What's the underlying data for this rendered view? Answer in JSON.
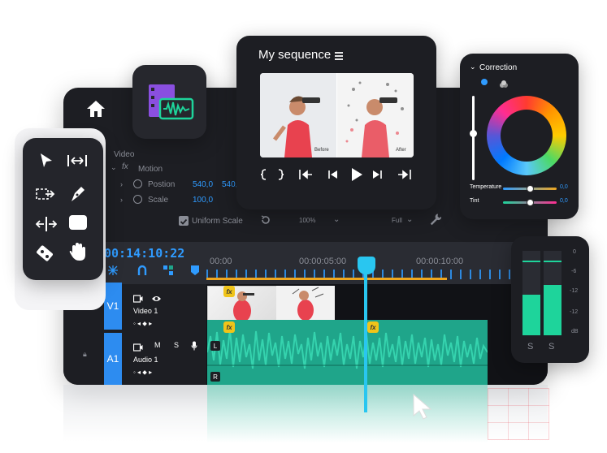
{
  "viewer": {
    "title": "My sequence",
    "before_label": "Before",
    "after_label": "After"
  },
  "effects": {
    "video_label": "Video",
    "motion_label": "Motion",
    "position_label": "Postion",
    "position_x": "540,0",
    "position_y": "540,",
    "scale_label": "Scale",
    "scale_value": "100,0",
    "uniform_scale_label": "Uniform Scale",
    "zoom_value": "100%",
    "quality_value": "Full"
  },
  "timeline": {
    "timecode": "00:14:10:22",
    "ruler": [
      "00:00",
      "00:00:05:00",
      "00:00:10:00"
    ],
    "tracks": [
      {
        "tag": "V1",
        "name": "Video 1",
        "vol": "0"
      },
      {
        "tag": "A1",
        "name": "Audio 1",
        "m_label": "M",
        "s_label": "S",
        "vol": "0",
        "left": "L",
        "right": "R"
      }
    ],
    "fx_label": "fx"
  },
  "correction": {
    "title": "Correction",
    "temperature_label": "Temperature",
    "temperature_value": "0,0",
    "tint_label": "Tint",
    "tint_value": "0,0"
  },
  "meter": {
    "scale": [
      "0",
      "-6",
      "-12",
      "-12",
      "dB"
    ],
    "s_left": "S",
    "s_right": "S"
  },
  "colors": {
    "accent": "#2f9bff",
    "audio": "#1fa58a",
    "meter": "#1ed49b",
    "badge": "#f0c419"
  },
  "icons": [
    "home-icon",
    "media-icon",
    "selection-tool-icon",
    "ripple-tool-icon",
    "slip-tool-icon",
    "pen-tool-icon",
    "move-tool-icon",
    "rectangle-tool-icon",
    "razor-tool-icon",
    "hand-tool-icon",
    "lock-icon",
    "eye-icon",
    "mic-icon",
    "wrench-icon",
    "reset-icon",
    "snap-icon",
    "linked-icon",
    "marker-icon",
    "cursor-icon",
    "hamburger-icon"
  ]
}
